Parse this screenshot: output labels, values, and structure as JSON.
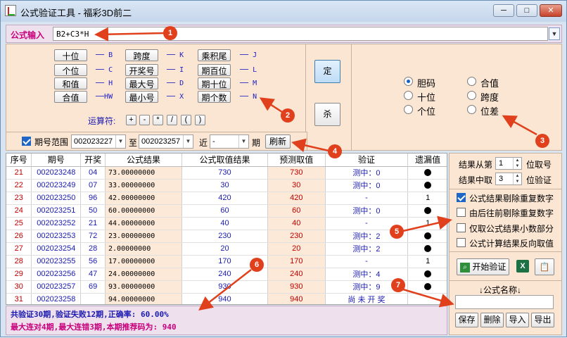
{
  "window": {
    "title": "公式验证工具 - 福彩3D前二",
    "min_label": "─",
    "max_label": "□",
    "close_label": "✕"
  },
  "formula": {
    "label": "公式输入",
    "value": "B2+C3*H"
  },
  "colors": {
    "accent": "#c8007c",
    "panel": "#fbe6d4",
    "annotation": "#e0401c"
  },
  "fields": [
    {
      "label": "十位",
      "letter": "B"
    },
    {
      "label": "个位",
      "letter": "C"
    },
    {
      "label": "和值",
      "letter": "H"
    },
    {
      "label": "合值",
      "letter": "HW"
    },
    {
      "label": "跨度",
      "letter": "K"
    },
    {
      "label": "开奖号",
      "letter": "I"
    },
    {
      "label": "最大号",
      "letter": "D"
    },
    {
      "label": "最小号",
      "letter": "X"
    },
    {
      "label": "乘积尾",
      "letter": "J"
    },
    {
      "label": "期百位",
      "letter": "L"
    },
    {
      "label": "期十位",
      "letter": "M"
    },
    {
      "label": "期个数",
      "letter": "N"
    }
  ],
  "operators": {
    "label": "运算符:",
    "ops": [
      "+",
      "-",
      "*",
      "/",
      "(",
      ")"
    ]
  },
  "actions": {
    "ding": "定",
    "sha": "杀"
  },
  "radio_options": [
    {
      "label": "胆码",
      "checked": true
    },
    {
      "label": "合值",
      "checked": false
    },
    {
      "label": "十位",
      "checked": false
    },
    {
      "label": "跨度",
      "checked": false
    },
    {
      "label": "个位",
      "checked": false
    },
    {
      "label": "位差",
      "checked": false
    }
  ],
  "range": {
    "checkbox_label": "期号范围",
    "from": "002023227",
    "to_label": "至",
    "to": "002023257",
    "near_label": "近",
    "near_value": "-",
    "period_label": "期",
    "refresh": "刷新"
  },
  "table": {
    "headers": [
      "序号",
      "期号",
      "开奖",
      "公式结果",
      "公式取值结果",
      "预测取值",
      "验证",
      "遗漏值"
    ],
    "rows": [
      {
        "no": "21",
        "id": "002023248",
        "kai": "04",
        "res": "73.00000000",
        "qz": "730",
        "pred": "730",
        "ver": "测中：0",
        "miss": "dot"
      },
      {
        "no": "22",
        "id": "002023249",
        "kai": "07",
        "res": "33.00000000",
        "qz": "30",
        "pred": "30",
        "ver": "测中：0",
        "miss": "dot"
      },
      {
        "no": "23",
        "id": "002023250",
        "kai": "96",
        "res": "42.00000000",
        "qz": "420",
        "pred": "420",
        "ver": "-",
        "miss": "1"
      },
      {
        "no": "24",
        "id": "002023251",
        "kai": "50",
        "res": "60.00000000",
        "qz": "60",
        "pred": "60",
        "ver": "测中：0",
        "miss": "dot"
      },
      {
        "no": "25",
        "id": "002023252",
        "kai": "21",
        "res": "44.00000000",
        "qz": "40",
        "pred": "40",
        "ver": "-",
        "miss": "1"
      },
      {
        "no": "26",
        "id": "002023253",
        "kai": "72",
        "res": "23.00000000",
        "qz": "230",
        "pred": "230",
        "ver": "测中：2",
        "miss": "dot"
      },
      {
        "no": "27",
        "id": "002023254",
        "kai": "28",
        "res": "2.00000000",
        "qz": "20",
        "pred": "20",
        "ver": "测中：2",
        "miss": "dot"
      },
      {
        "no": "28",
        "id": "002023255",
        "kai": "56",
        "res": "17.00000000",
        "qz": "170",
        "pred": "170",
        "ver": "-",
        "miss": "1"
      },
      {
        "no": "29",
        "id": "002023256",
        "kai": "47",
        "res": "24.00000000",
        "qz": "240",
        "pred": "240",
        "ver": "测中：4",
        "miss": "dot"
      },
      {
        "no": "30",
        "id": "002023257",
        "kai": "69",
        "res": "93.00000000",
        "qz": "930",
        "pred": "930",
        "ver": "测中：9",
        "miss": "dot"
      },
      {
        "no": "31",
        "id": "002023258",
        "kai": "",
        "res": "94.00000000",
        "qz": "940",
        "pred": "940",
        "ver": "尚 未 开 奖",
        "miss": ""
      }
    ]
  },
  "status": {
    "line1": "共验证30期,验证失败12期,正确率: 60.00%",
    "line2": "最大连对4期,最大连错3期,本期推荐码为: 940"
  },
  "right": {
    "from_label": "结果从第",
    "from_value": "1",
    "from_suffix": "位取号",
    "mid_label": "结果中取",
    "mid_value": "3",
    "mid_suffix": "位验证",
    "options": [
      {
        "label": "公式结果剔除重复数字",
        "checked": true
      },
      {
        "label": "由后往前剔除重复数字",
        "checked": false
      },
      {
        "label": "仅取公式结果小数部分",
        "checked": false
      },
      {
        "label": "公式计算结果反向取值",
        "checked": false
      }
    ],
    "start": "开始验证",
    "name_header": "↓公式名称↓",
    "name_value": "",
    "buttons": [
      "保存",
      "删除",
      "导入",
      "导出"
    ]
  },
  "annotations": [
    "1",
    "2",
    "3",
    "4",
    "5",
    "6",
    "7"
  ]
}
